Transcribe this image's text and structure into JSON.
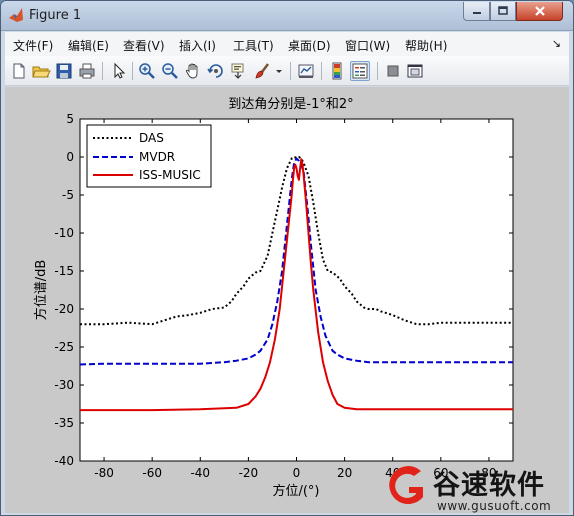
{
  "window": {
    "title": "Figure 1"
  },
  "menu": {
    "items": [
      "文件(F)",
      "编辑(E)",
      "查看(V)",
      "插入(I)",
      "工具(T)",
      "桌面(D)",
      "窗口(W)",
      "帮助(H)"
    ]
  },
  "toolbar": {
    "buttons": [
      {
        "name": "new-figure",
        "icon": "new-file-icon"
      },
      {
        "name": "open-file",
        "icon": "folder-open-icon"
      },
      {
        "name": "save-figure",
        "icon": "save-icon"
      },
      {
        "name": "print-figure",
        "icon": "printer-icon"
      },
      {
        "name": "edit-plot",
        "icon": "pointer-arrow-icon"
      },
      {
        "name": "zoom-in",
        "icon": "zoom-in-icon"
      },
      {
        "name": "zoom-out",
        "icon": "zoom-out-icon"
      },
      {
        "name": "pan",
        "icon": "hand-icon"
      },
      {
        "name": "rotate-3d",
        "icon": "rotate-icon"
      },
      {
        "name": "data-cursor",
        "icon": "data-cursor-icon"
      },
      {
        "name": "brush",
        "icon": "brush-icon"
      },
      {
        "name": "link-plot",
        "icon": "link-plot-icon"
      },
      {
        "name": "insert-colorbar",
        "icon": "colorbar-icon"
      },
      {
        "name": "insert-legend",
        "icon": "legend-icon"
      },
      {
        "name": "hide-plot-tools",
        "icon": "hide-tools-icon"
      },
      {
        "name": "show-plot-tools",
        "icon": "show-tools-icon"
      }
    ]
  },
  "chart_data": {
    "type": "line",
    "title": "到达角分别是-1°和2°",
    "xlabel": "方位/(°)",
    "ylabel": "方位谱/dB",
    "xlim": [
      -90,
      90
    ],
    "ylim": [
      -40,
      5
    ],
    "xticks": [
      -80,
      -60,
      -40,
      -20,
      0,
      20,
      40,
      60,
      80
    ],
    "yticks": [
      5,
      0,
      -5,
      -10,
      -15,
      -20,
      -25,
      -30,
      -35,
      -40
    ],
    "legend_position": "top-left",
    "series": [
      {
        "name": "DAS",
        "color": "#000000",
        "style": "dotted",
        "x": [
          -90,
          -80,
          -70,
          -60,
          -55,
          -50,
          -45,
          -40,
          -35,
          -30,
          -27,
          -25,
          -22,
          -20,
          -17,
          -15,
          -12,
          -10,
          -8,
          -6,
          -4,
          -2,
          -1,
          0,
          1,
          2,
          3,
          5,
          7,
          9,
          11,
          13,
          15,
          18,
          20,
          23,
          25,
          28,
          30,
          33,
          35,
          40,
          45,
          50,
          55,
          60,
          65,
          70,
          80,
          90
        ],
        "y": [
          -22,
          -22,
          -21.8,
          -22,
          -21.5,
          -21,
          -20.8,
          -20.5,
          -20,
          -19.8,
          -19,
          -18,
          -17,
          -16,
          -15.2,
          -15,
          -13,
          -10,
          -7,
          -4,
          -1.5,
          -0.2,
          0,
          -0.1,
          0,
          -0.2,
          -0.8,
          -2.5,
          -6,
          -10,
          -13.5,
          -15,
          -15.2,
          -16,
          -17,
          -18,
          -19,
          -19.8,
          -20,
          -20,
          -20.3,
          -20.8,
          -21.5,
          -22,
          -22,
          -21.8,
          -21.8,
          -21.8,
          -21.8,
          -21.8
        ]
      },
      {
        "name": "MVDR",
        "color": "#0000cc",
        "style": "dashed",
        "x": [
          -90,
          -80,
          -60,
          -40,
          -30,
          -25,
          -20,
          -17,
          -15,
          -12,
          -10,
          -8,
          -6,
          -5,
          -4,
          -3,
          -2,
          -1,
          0,
          1,
          2,
          3,
          4,
          5,
          6,
          7,
          8,
          10,
          12,
          15,
          17,
          20,
          25,
          30,
          40,
          60,
          80,
          90
        ],
        "y": [
          -27.3,
          -27.2,
          -27.2,
          -27.2,
          -27,
          -26.8,
          -26.5,
          -26,
          -25.5,
          -24,
          -22,
          -19,
          -15,
          -12,
          -9,
          -6,
          -3,
          -0.8,
          -0.2,
          -0.5,
          -1,
          -2,
          -5,
          -8,
          -11.5,
          -14.5,
          -17.5,
          -21,
          -23.5,
          -25.5,
          -26,
          -26.5,
          -26.8,
          -27,
          -27,
          -27,
          -27,
          -27
        ]
      },
      {
        "name": "ISS-MUSIC",
        "color": "#dd0000",
        "style": "solid",
        "x": [
          -90,
          -60,
          -40,
          -25,
          -20,
          -17,
          -15,
          -13,
          -11,
          -9,
          -7,
          -6,
          -5,
          -4,
          -3,
          -2,
          -1.5,
          -1,
          -0.5,
          0,
          0.5,
          1,
          1.5,
          2,
          2.5,
          3,
          4,
          5,
          6,
          7,
          9,
          11,
          13,
          15,
          17,
          20,
          25,
          40,
          60,
          90
        ],
        "y": [
          -33.3,
          -33.3,
          -33.2,
          -33,
          -32.5,
          -31.5,
          -30.5,
          -29,
          -27,
          -24,
          -20,
          -17,
          -14,
          -11,
          -8,
          -5,
          -3,
          -1.5,
          -1,
          -1.5,
          -2.5,
          -3,
          -1.5,
          -0.3,
          -1,
          -2.5,
          -6,
          -10,
          -14,
          -17.5,
          -23,
          -27,
          -29.5,
          -31.3,
          -32.5,
          -33,
          -33.2,
          -33.2,
          -33.2,
          -33.2
        ]
      }
    ]
  },
  "watermark": {
    "brand": "谷速软件",
    "url": "www.gusuoft.com"
  }
}
